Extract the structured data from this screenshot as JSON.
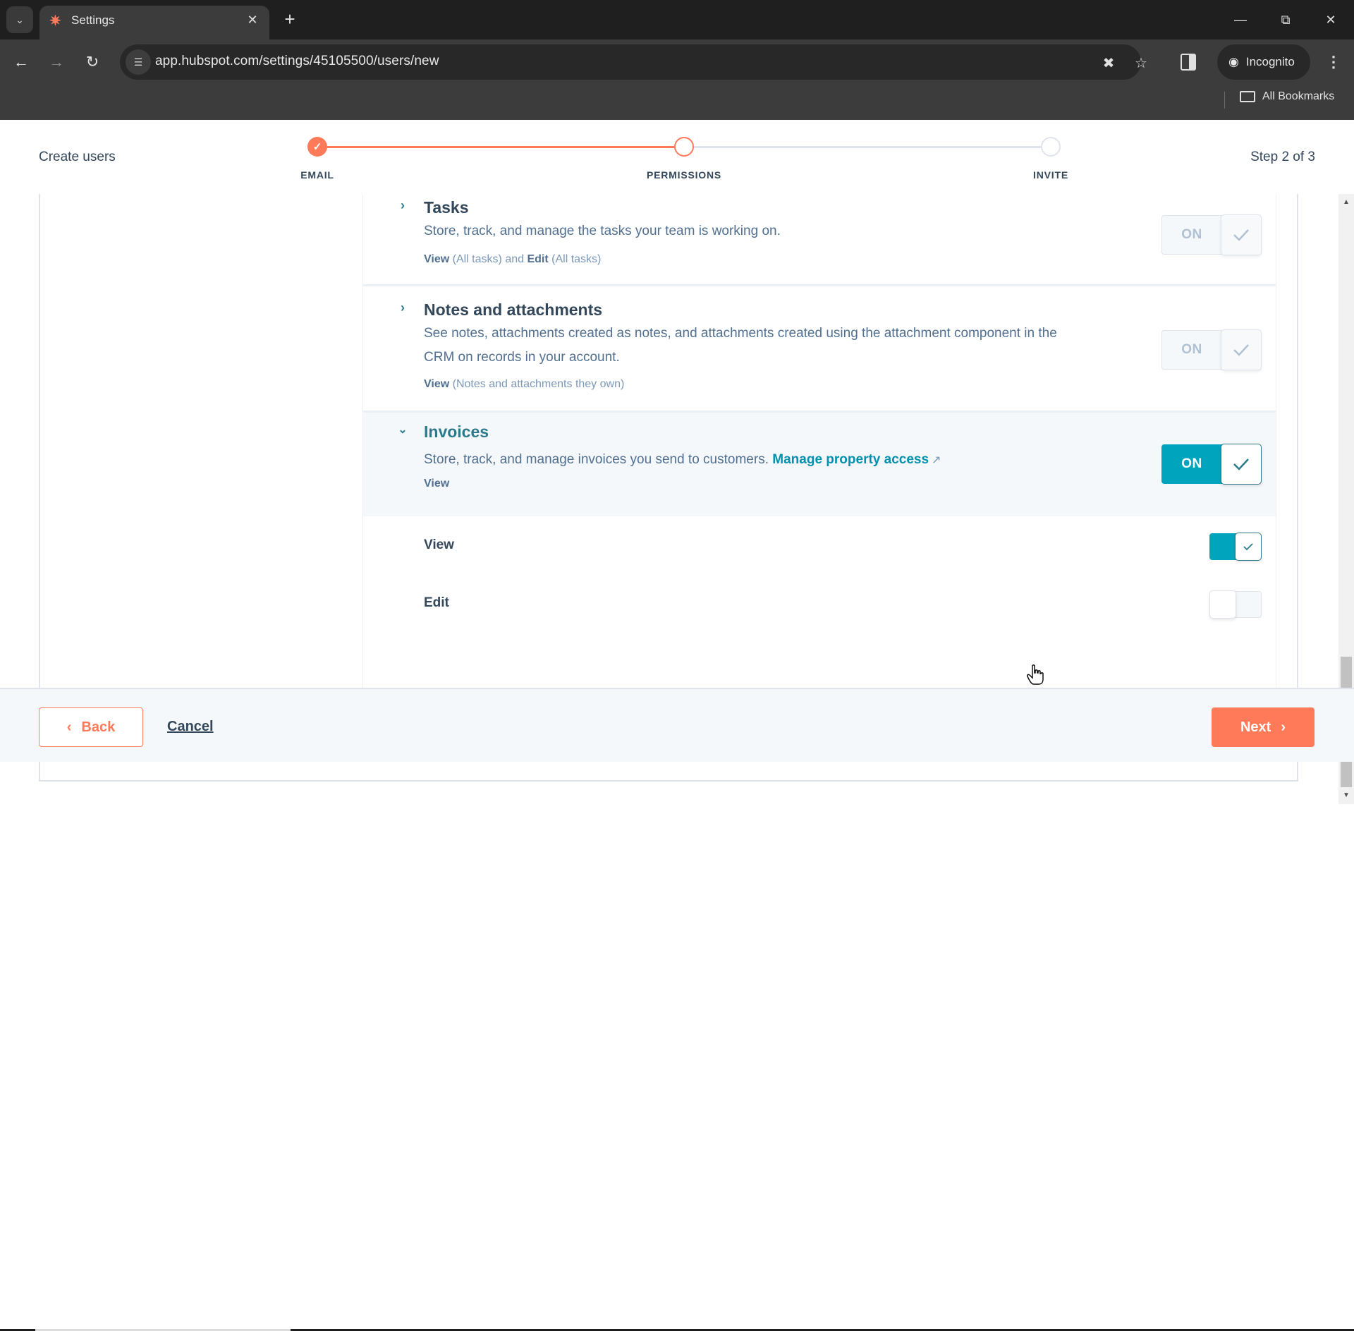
{
  "browser": {
    "tab_title": "Settings",
    "tab_favicon": "hubspot-icon",
    "url": "app.hubspot.com/settings/45105500/users/new",
    "incognito_label": "Incognito",
    "bookmarks_label": "All Bookmarks"
  },
  "header": {
    "title": "Create users",
    "step_count": "Step 2 of 3"
  },
  "stepper": {
    "steps": [
      {
        "label": "EMAIL",
        "state": "completed"
      },
      {
        "label": "PERMISSIONS",
        "state": "current"
      },
      {
        "label": "INVITE",
        "state": "upcoming"
      }
    ]
  },
  "sections": [
    {
      "title": "Tasks",
      "expanded": false,
      "description": "Store, track, and manage the tasks your team is working on.",
      "perm_view": "View",
      "perm_view_scope": "(All tasks)",
      "perm_and": "and",
      "perm_edit": "Edit",
      "perm_edit_scope": "(All tasks)",
      "toggle_label": "ON",
      "toggle_state": "on-disabled"
    },
    {
      "title": "Notes and attachments",
      "expanded": false,
      "description": "See notes, attachments created as notes, and attachments created using the attachment component in the CRM on records in your account.",
      "perm_view": "View",
      "perm_view_scope": "(Notes and attachments they own)",
      "toggle_label": "ON",
      "toggle_state": "on-disabled"
    },
    {
      "title": "Invoices",
      "expanded": true,
      "description": "Store, track, and manage invoices you send to customers.",
      "link_label": "Manage property access",
      "perm_view": "View",
      "toggle_label": "ON",
      "toggle_state": "on",
      "sub_permissions": [
        {
          "label": "View",
          "enabled": true
        },
        {
          "label": "Edit",
          "enabled": false
        }
      ]
    }
  ],
  "footer": {
    "back_label": "Back",
    "cancel_label": "Cancel",
    "next_label": "Next"
  },
  "colors": {
    "accent_orange": "#ff7a59",
    "toggle_teal": "#00a4bd",
    "link_teal": "#0091ae",
    "text_dark": "#33475b"
  }
}
